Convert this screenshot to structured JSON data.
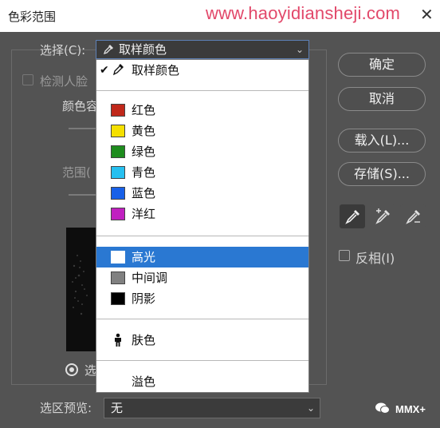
{
  "window": {
    "title": "色彩范围",
    "watermark": "www.haoyidiansheji.com",
    "close_glyph": "✕"
  },
  "select": {
    "label": "选择(C):",
    "value": "取样颜色",
    "chevron": "⌄",
    "options": [
      {
        "label": "取样颜色",
        "checked": true,
        "icon": "eyedropper-icon"
      },
      {
        "label": "红色",
        "color": "#c0281a"
      },
      {
        "label": "黄色",
        "color": "#f5e000"
      },
      {
        "label": "绿色",
        "color": "#1e8c1e"
      },
      {
        "label": "青色",
        "color": "#27c0f0"
      },
      {
        "label": "蓝色",
        "color": "#1860e8"
      },
      {
        "label": "洋红",
        "color": "#c020c0"
      },
      {
        "label": "高光",
        "color": "#ffffff",
        "selected": true
      },
      {
        "label": "中间调",
        "color": "#808080"
      },
      {
        "label": "阴影",
        "color": "#000000"
      },
      {
        "label": "肤色",
        "icon": "person-icon"
      },
      {
        "label": "溢色"
      }
    ]
  },
  "left_panel": {
    "detect_faces": "检测人脸",
    "color_label_partial": "颜色容",
    "range_label_partial": "范围(",
    "radio_partial": "选"
  },
  "buttons": {
    "ok": "确定",
    "cancel": "取消",
    "load": "载入(L)...",
    "save": "存储(S)..."
  },
  "invert": {
    "label": "反相(I)",
    "checked": false
  },
  "preview": {
    "label": "选区预览:",
    "value": "无",
    "chevron": "⌄"
  },
  "badge": "MMX+",
  "colors": {
    "dialog_bg": "#535353",
    "highlight": "#2a78d2",
    "watermark": "#e2486a"
  }
}
